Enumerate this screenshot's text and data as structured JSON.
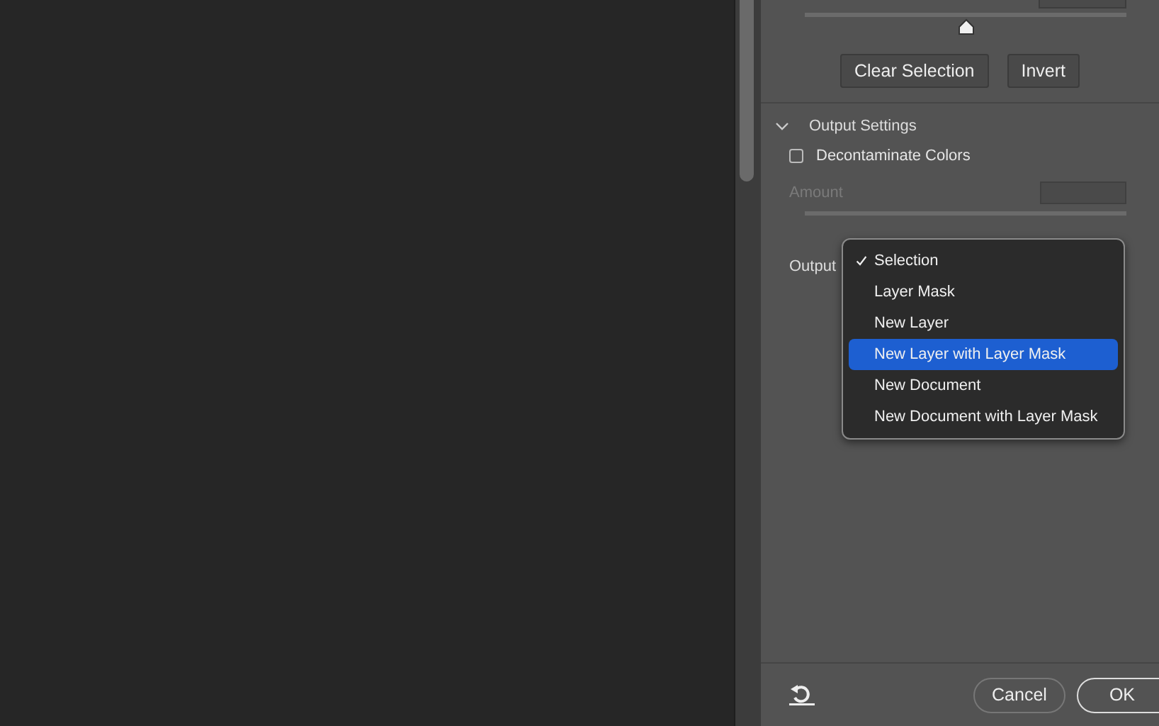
{
  "edge_slider": {
    "level": 0.5
  },
  "buttons": [
    "Clear Selection",
    "Invert"
  ],
  "output_settings": {
    "title": "Output Settings",
    "expanded": true,
    "decontaminate": {
      "label": "Decontaminate Colors",
      "checked": false
    },
    "amount": {
      "label": "Amount",
      "disabled": true
    },
    "output": {
      "label": "Output"
    }
  },
  "output_menu": [
    {
      "label": "Selection",
      "checked": true,
      "selected": false
    },
    {
      "label": "Layer Mask",
      "checked": false,
      "selected": false
    },
    {
      "label": "New Layer",
      "checked": false,
      "selected": false
    },
    {
      "label": "New Layer with Layer Mask",
      "checked": false,
      "selected": true
    },
    {
      "label": "New Document",
      "checked": false,
      "selected": false
    },
    {
      "label": "New Document with Layer Mask",
      "checked": false,
      "selected": false
    }
  ],
  "footer": {
    "cancel": "Cancel",
    "ok": "OK"
  }
}
